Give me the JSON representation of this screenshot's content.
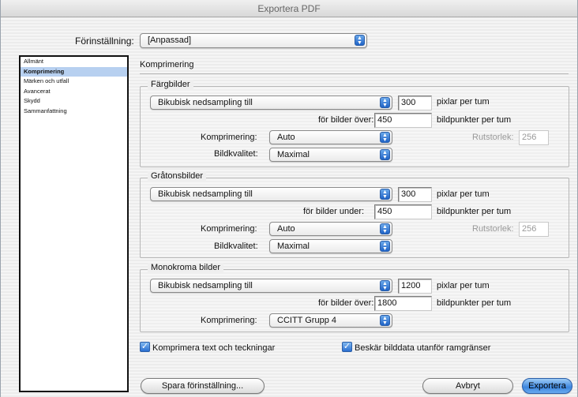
{
  "window": {
    "title": "Exportera PDF"
  },
  "preset": {
    "label": "Förinställning:",
    "value": "[Anpassad]"
  },
  "sidebar": {
    "items": [
      {
        "label": "Allmänt"
      },
      {
        "label": "Komprimering"
      },
      {
        "label": "Märken och utfall"
      },
      {
        "label": "Avancerat"
      },
      {
        "label": "Skydd"
      },
      {
        "label": "Sammanfattning"
      }
    ]
  },
  "panel": {
    "title": "Komprimering"
  },
  "color": {
    "title": "Färgbilder",
    "sampling": "Bikubisk nedsampling till",
    "ppi": "300",
    "ppi_unit": "pixlar per tum",
    "above_label": "för bilder över:",
    "above_value": "450",
    "above_unit": "bildpunkter per tum",
    "compression_label": "Komprimering:",
    "compression": "Auto",
    "quality_label": "Bildkvalitet:",
    "quality": "Maximal",
    "tile_label": "Rutstorlek:",
    "tile_value": "256"
  },
  "gray": {
    "title": "Gråtonsbilder",
    "sampling": "Bikubisk nedsampling till",
    "ppi": "300",
    "ppi_unit": "pixlar per tum",
    "above_label": "för bilder under:",
    "above_value": "450",
    "above_unit": "bildpunkter per tum",
    "compression_label": "Komprimering:",
    "compression": "Auto",
    "quality_label": "Bildkvalitet:",
    "quality": "Maximal",
    "tile_label": "Rutstorlek:",
    "tile_value": "256"
  },
  "mono": {
    "title": "Monokroma bilder",
    "sampling": "Bikubisk nedsampling till",
    "ppi": "1200",
    "ppi_unit": "pixlar per tum",
    "above_label": "för bilder över:",
    "above_value": "1800",
    "above_unit": "bildpunkter per tum",
    "compression_label": "Komprimering:",
    "compression": "CCITT Grupp 4"
  },
  "options": {
    "compress_text": "Komprimera text och teckningar",
    "crop_images": "Beskär bilddata utanför ramgränser"
  },
  "buttons": {
    "save_preset": "Spara förinställning...",
    "cancel": "Avbryt",
    "export": "Exportera"
  },
  "colors": {
    "accent": "#3c86de",
    "selection": "#b7d0f0"
  }
}
